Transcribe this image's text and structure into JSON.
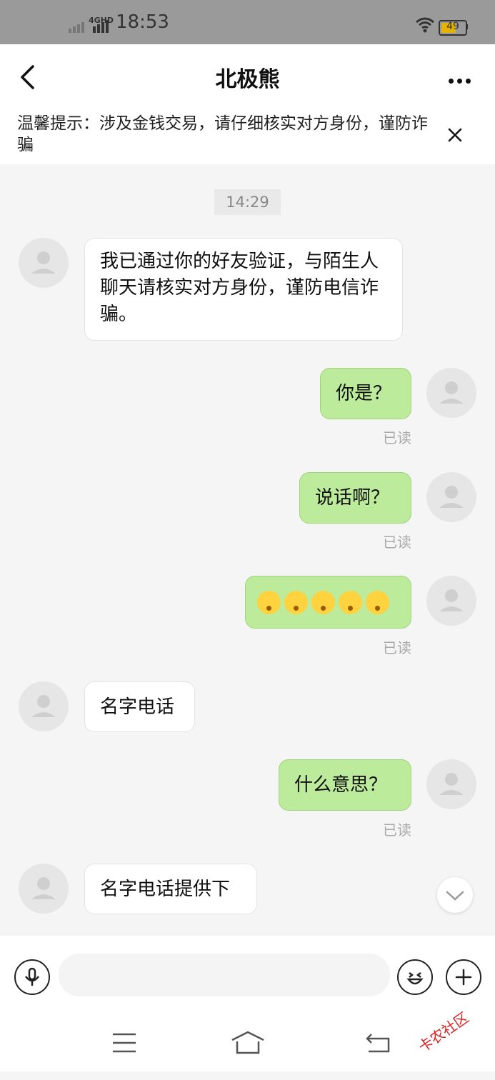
{
  "status_bar": {
    "time": "18:53",
    "network": "4GHD",
    "battery": "49"
  },
  "header": {
    "title": "北极熊"
  },
  "notice": {
    "text": "温馨提示：涉及金钱交易，请仔细核实对方身份，谨防诈骗"
  },
  "chat": {
    "timestamp": "14:29",
    "messages": [
      {
        "from": "other",
        "text": "我已通过你的好友验证，与陌生人聊天请核实对方身份，谨防电信诈骗。"
      },
      {
        "from": "me",
        "text": "你是？",
        "status": "已读"
      },
      {
        "from": "me",
        "text": "说话啊？",
        "status": "已读"
      },
      {
        "from": "me",
        "emoji_count": 5,
        "status": "已读"
      },
      {
        "from": "other",
        "text": "名字电话"
      },
      {
        "from": "me",
        "text": "什么意思？",
        "status": "已读"
      },
      {
        "from": "other",
        "text": "名字电话提供下"
      }
    ]
  },
  "watermark": {
    "text": "卡农社区"
  },
  "colors": {
    "sent_bubble": "#bdeb9c",
    "received_bubble": "#ffffff",
    "battery": "#e6b400"
  }
}
